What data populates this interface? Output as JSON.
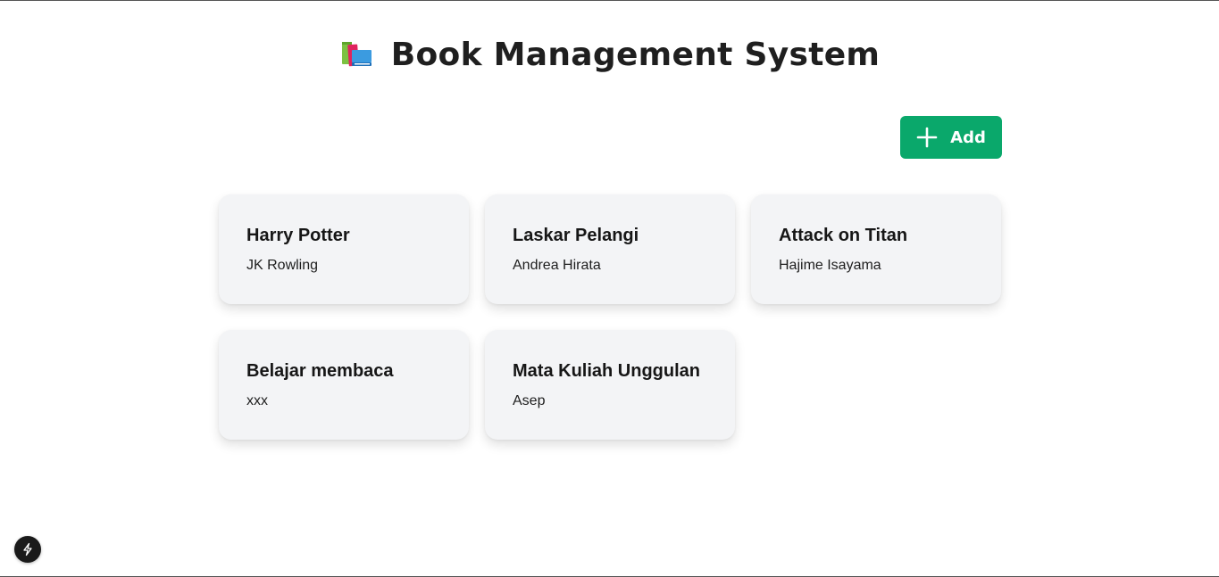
{
  "header": {
    "title": "Book Management System",
    "icon": "books-icon"
  },
  "toolbar": {
    "add_label": "Add",
    "add_icon": "plus-icon",
    "accent_color": "#0aa86b"
  },
  "books": [
    {
      "title": "Harry Potter",
      "author": "JK Rowling"
    },
    {
      "title": "Laskar Pelangi",
      "author": "Andrea Hirata"
    },
    {
      "title": "Attack on Titan",
      "author": "Hajime Isayama"
    },
    {
      "title": "Belajar membaca",
      "author": "xxx"
    },
    {
      "title": "Mata Kuliah Unggulan",
      "author": "Asep"
    }
  ],
  "dev_indicator": {
    "icon": "lightning-icon"
  }
}
